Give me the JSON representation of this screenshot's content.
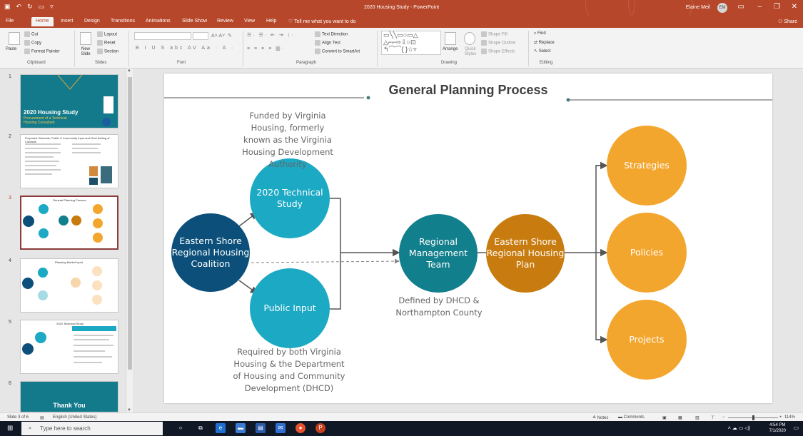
{
  "window": {
    "document_title": "2020 Housing Study - PowerPoint",
    "user_name": "Elaine Meil",
    "user_initials": "EM"
  },
  "ribbon_tabs": [
    "File",
    "Home",
    "Insert",
    "Design",
    "Transitions",
    "Animations",
    "Slide Show",
    "Review",
    "View",
    "Help"
  ],
  "tell_me": "Tell me what you want to do",
  "share_label": "Share",
  "ribbon": {
    "clipboard": {
      "paste": "Paste",
      "cut": "Cut",
      "copy": "Copy",
      "format_painter": "Format Painter",
      "label": "Clipboard"
    },
    "slides": {
      "new_slide": "New Slide",
      "layout": "Layout",
      "reset": "Reset",
      "section": "Section",
      "label": "Slides"
    },
    "font": {
      "label": "Font"
    },
    "paragraph": {
      "text_direction": "Text Direction",
      "align_text": "Align Text",
      "convert_smartart": "Convert to SmartArt",
      "label": "Paragraph"
    },
    "drawing": {
      "arrange": "Arrange",
      "quick_styles": "Quick Styles",
      "shape_fill": "Shape Fill",
      "shape_outline": "Shape Outline",
      "shape_effects": "Shape Effects",
      "label": "Drawing"
    },
    "editing": {
      "find": "Find",
      "replace": "Replace",
      "select": "Select",
      "label": "Editing"
    }
  },
  "thumbnails": {
    "numbers": [
      "1",
      "2",
      "3",
      "4",
      "5",
      "6"
    ],
    "slide1_title": "2020 Housing Study",
    "slide1_subtitle": "Procurement of a Technical Housing Consultant",
    "slide2_title": "Proposed Schedule, Public & Community Input and Goal Setting of Contacts",
    "slide3_title": "General Planning Process",
    "slide4_title": "Planning Market Input",
    "slide5_title": "2020 Technical Study",
    "slide6_title": "Thank You"
  },
  "slide": {
    "title": "General Planning Process",
    "nodes": {
      "coalition": "Eastern Shore Regional Housing Coalition",
      "technical_study": "2020 Technical Study",
      "public_input": "Public Input",
      "management_team": "Regional Management Team",
      "housing_plan": "Eastern Shore Regional Housing Plan",
      "strategies": "Strategies",
      "policies": "Policies",
      "projects": "Projects"
    },
    "notes": {
      "funded": "Funded by Virginia Housing, formerly known as the Virginia Housing Development Authority",
      "defined": "Defined by DHCD & Northampton County",
      "required": "Required by both Virginia Housing & the Department of Housing and Community Development (DHCD)"
    },
    "colors": {
      "dark_blue": "#0b4f7a",
      "teal": "#1ba9c4",
      "dark_teal": "#127f8c",
      "dark_orange": "#c87b0e",
      "orange": "#f3a62d"
    }
  },
  "statusbar": {
    "slide_indicator": "Slide 3 of 6",
    "language": "English (United States)",
    "notes": "Notes",
    "comments": "Comments",
    "zoom": "114%"
  },
  "taskbar": {
    "search_placeholder": "Type here to search",
    "time": "4:54 PM",
    "date": "7/1/2020"
  }
}
